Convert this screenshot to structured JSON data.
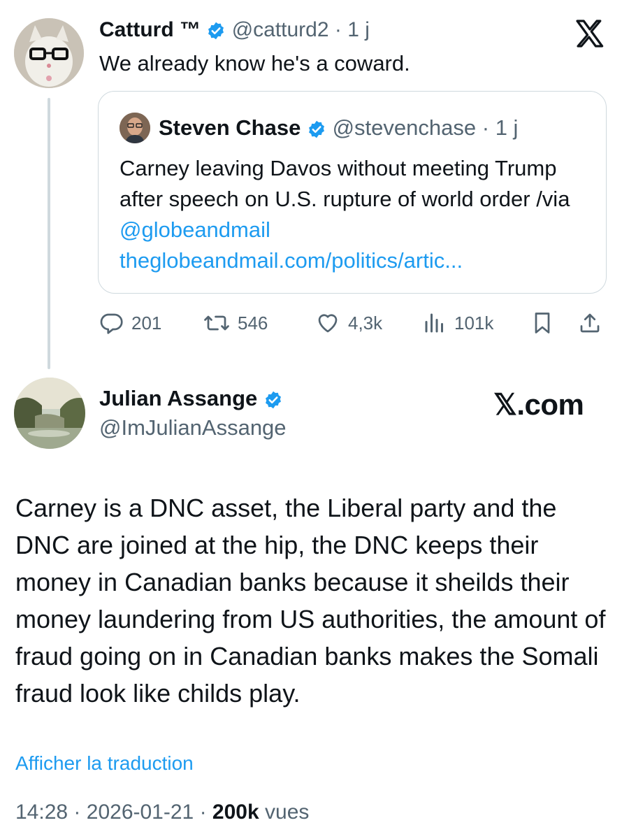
{
  "parent_tweet": {
    "author_name": "Catturd ™",
    "handle": "@catturd2",
    "separator": "·",
    "time": "1 j",
    "text": "We already know he's a coward."
  },
  "quoted_tweet": {
    "author_name": "Steven Chase",
    "handle": "@stevenchase",
    "separator": "·",
    "time": "1 j",
    "text_before_mention": "Carney leaving Davos without meeting Trump after speech on U.S. rupture of world order /via ",
    "mention": "@globeandmail",
    "link": "theglobeandmail.com/politics/artic..."
  },
  "actions": {
    "replies": "201",
    "reposts": "546",
    "likes": "4,3k",
    "views": "101k"
  },
  "card": {
    "author_name": "Julian Assange",
    "handle": "@ImJulianAssange",
    "brand": "𝕏.com",
    "text": "Carney is a DNC asset, the Liberal party and the DNC are joined at the hip, the DNC keeps their money in Canadian banks because it sheilds their money laundering from US authorities, the amount of fraud going on in Canadian banks makes the Somali fraud look like childs play.",
    "translate_label": "Afficher la traduction",
    "time": "14:28",
    "date": "2026-01-21",
    "separator": "·",
    "views_count": "200k",
    "views_label": "vues"
  },
  "colors": {
    "link": "#1d9bf0",
    "muted": "#536471",
    "border": "#cfd9de",
    "text": "#0f1419"
  },
  "icons": [
    "x-logo-icon",
    "verified-badge-icon",
    "reply-icon",
    "repost-icon",
    "like-icon",
    "views-icon",
    "bookmark-icon",
    "share-icon"
  ]
}
